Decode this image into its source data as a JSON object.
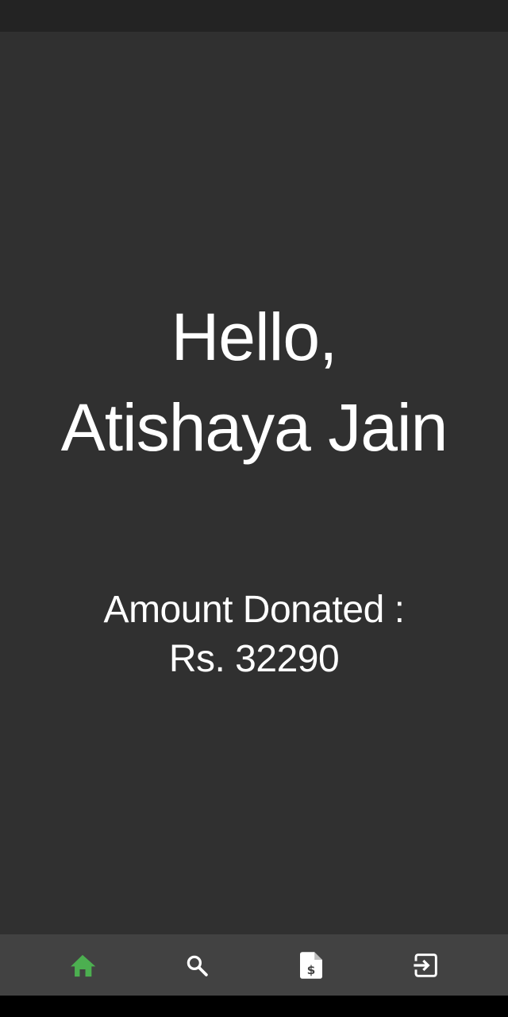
{
  "greeting": {
    "hello": "Hello,",
    "name": "Atishaya Jain"
  },
  "donation": {
    "label": "Amount Donated :",
    "value": "Rs. 32290"
  },
  "bottom_nav": {
    "active_color": "#4CAF50",
    "inactive_color": "#FFFFFF",
    "items": [
      {
        "icon": "home-icon",
        "active": true
      },
      {
        "icon": "search-icon",
        "active": false
      },
      {
        "icon": "dollar-document-icon",
        "active": false
      },
      {
        "icon": "logout-icon",
        "active": false
      }
    ]
  }
}
